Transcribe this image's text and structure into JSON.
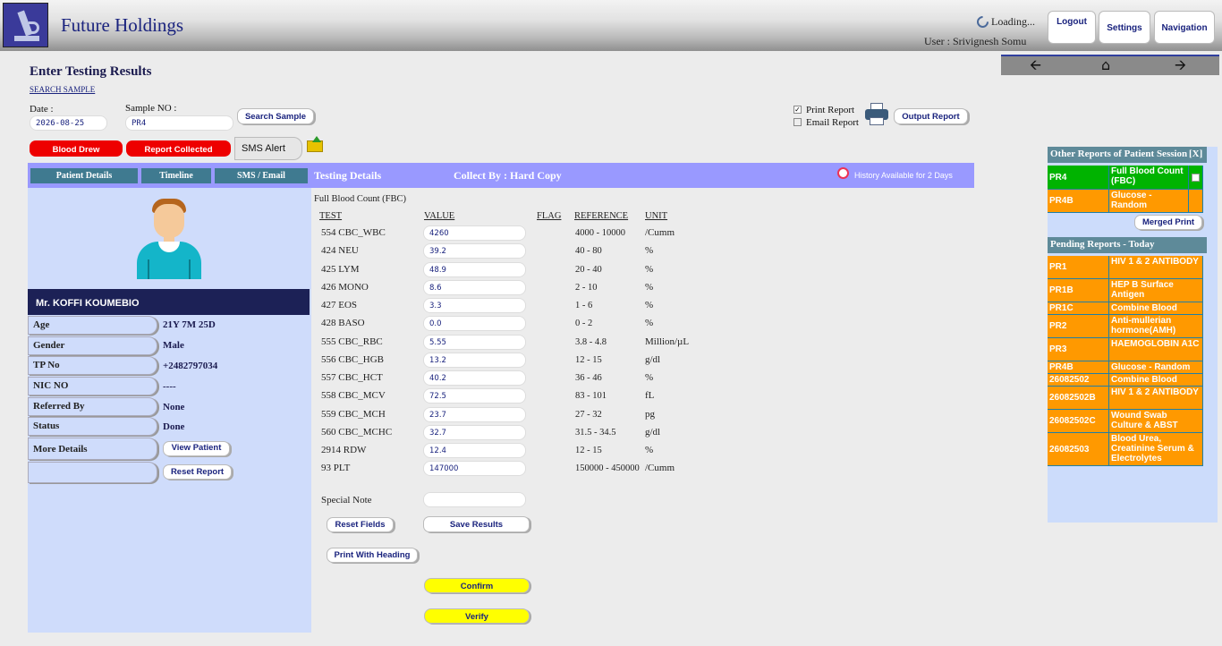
{
  "header": {
    "brand": "Future Holdings",
    "loading": "Loading...",
    "user": "User : Srivignesh Somu",
    "buttons": [
      "Logout",
      "Settings",
      "Navigation"
    ]
  },
  "nav_arrows": [
    "back-arrow-icon",
    "home-icon",
    "forward-arrow-icon"
  ],
  "page": {
    "title": "Enter Testing Results",
    "search_link": "SEARCH SAMPLE",
    "date_label": "Date :",
    "date_value": "2026-08-25",
    "sample_label": "Sample NO :",
    "sample_value": "PR4",
    "search_button": "Search Sample",
    "print_report": "Print Report",
    "email_report": "Email Report",
    "print_report_checked": true,
    "email_report_checked": false,
    "output_report": "Output Report",
    "blood_drew": "Blood Drew",
    "report_collected": "Report Collected",
    "sms_alert": "SMS Alert"
  },
  "tabs": [
    "Patient Details",
    "Timeline",
    "SMS / Email"
  ],
  "testing_header": {
    "label": "Testing Details",
    "collect_by": "Collect By : Hard Copy",
    "history": "History Available for 2 Days"
  },
  "patient": {
    "name": "Mr. KOFFI KOUMEBIO",
    "fields": [
      {
        "label": "Age",
        "value": "21Y 7M 25D"
      },
      {
        "label": "Gender",
        "value": "Male"
      },
      {
        "label": "TP No",
        "value": "+2482797034"
      },
      {
        "label": "NIC NO",
        "value": "----"
      },
      {
        "label": "Referred By",
        "value": "None"
      },
      {
        "label": "Status",
        "value": "Done"
      }
    ],
    "more_details": "More Details",
    "view_patient": "View Patient",
    "reset_report": "Reset Report"
  },
  "results": {
    "test_name": "Full Blood Count (FBC)",
    "columns": [
      "TEST",
      "VALUE",
      "FLAG",
      "REFERENCE",
      "UNIT"
    ],
    "rows": [
      {
        "test": "554 CBC_WBC",
        "value": "4260",
        "reference": "4000 - 10000",
        "unit": "/Cumm"
      },
      {
        "test": "424 NEU",
        "value": "39.2",
        "reference": "40 - 80",
        "unit": "%"
      },
      {
        "test": "425 LYM",
        "value": "48.9",
        "reference": "20 - 40",
        "unit": "%"
      },
      {
        "test": "426 MONO",
        "value": "8.6",
        "reference": "2 - 10",
        "unit": "%"
      },
      {
        "test": "427 EOS",
        "value": "3.3",
        "reference": "1 - 6",
        "unit": "%"
      },
      {
        "test": "428 BASO",
        "value": "0.0",
        "reference": "0 - 2",
        "unit": "%"
      },
      {
        "test": "555 CBC_RBC",
        "value": "5.55",
        "reference": "3.8 - 4.8",
        "unit": "Million/µL"
      },
      {
        "test": "556 CBC_HGB",
        "value": "13.2",
        "reference": "12 - 15",
        "unit": "g/dl"
      },
      {
        "test": "557 CBC_HCT",
        "value": "40.2",
        "reference": "36 - 46",
        "unit": "%"
      },
      {
        "test": "558 CBC_MCV",
        "value": "72.5",
        "reference": "83 - 101",
        "unit": "fL"
      },
      {
        "test": "559 CBC_MCH",
        "value": "23.7",
        "reference": "27 - 32",
        "unit": "pg"
      },
      {
        "test": "560 CBC_MCHC",
        "value": "32.7",
        "reference": "31.5 - 34.5",
        "unit": "g/dl"
      },
      {
        "test": "2914 RDW",
        "value": "12.4",
        "reference": "12 - 15",
        "unit": "%"
      },
      {
        "test": "93 PLT",
        "value": "147000",
        "reference": "150000 - 450000",
        "unit": "/Cumm"
      }
    ],
    "special_note_label": "Special Note",
    "reset_fields": "Reset Fields",
    "save_results": "Save Results",
    "print_with_heading": "Print With Heading",
    "confirm": "Confirm",
    "verify": "Verify"
  },
  "other_reports": {
    "title": "Other Reports of Patient Session",
    "close": "[X]",
    "items": [
      {
        "id": "PR4",
        "test": "Full Blood Count (FBC)",
        "active": true
      },
      {
        "id": "PR4B",
        "test": "Glucose - Random",
        "active": false
      }
    ],
    "merged_print": "Merged Print"
  },
  "pending_reports": {
    "title": "Pending Reports - Today",
    "items": [
      {
        "id": "PR1",
        "test": "HIV 1 & 2 ANTIBODY"
      },
      {
        "id": "PR1B",
        "test": "HEP B Surface Antigen"
      },
      {
        "id": "PR1C",
        "test": "Combine Blood Tests"
      },
      {
        "id": "PR2",
        "test": "Anti-mullerian hormone(AMH)"
      },
      {
        "id": "PR3",
        "test": "HAEMOGLOBIN A1C"
      },
      {
        "id": "PR4B",
        "test": "Glucose - Random"
      },
      {
        "id": "26082502",
        "test": "Combine Blood Tests"
      },
      {
        "id": "26082502B",
        "test": "HIV 1 & 2 ANTIBODY"
      },
      {
        "id": "26082502C",
        "test": "Wound Swab Culture & ABST"
      },
      {
        "id": "26082503",
        "test": "Blood Urea, Creatinine Serum & Electrolytes"
      }
    ]
  },
  "colors": {
    "brand": "#1a237e",
    "bar": "#9999ff",
    "tab": "#3f7a90",
    "panel": "#cfdcfb",
    "orange": "#ff9900",
    "green": "#00b300",
    "red": "#ee0000",
    "yellow": "#ffff00"
  }
}
